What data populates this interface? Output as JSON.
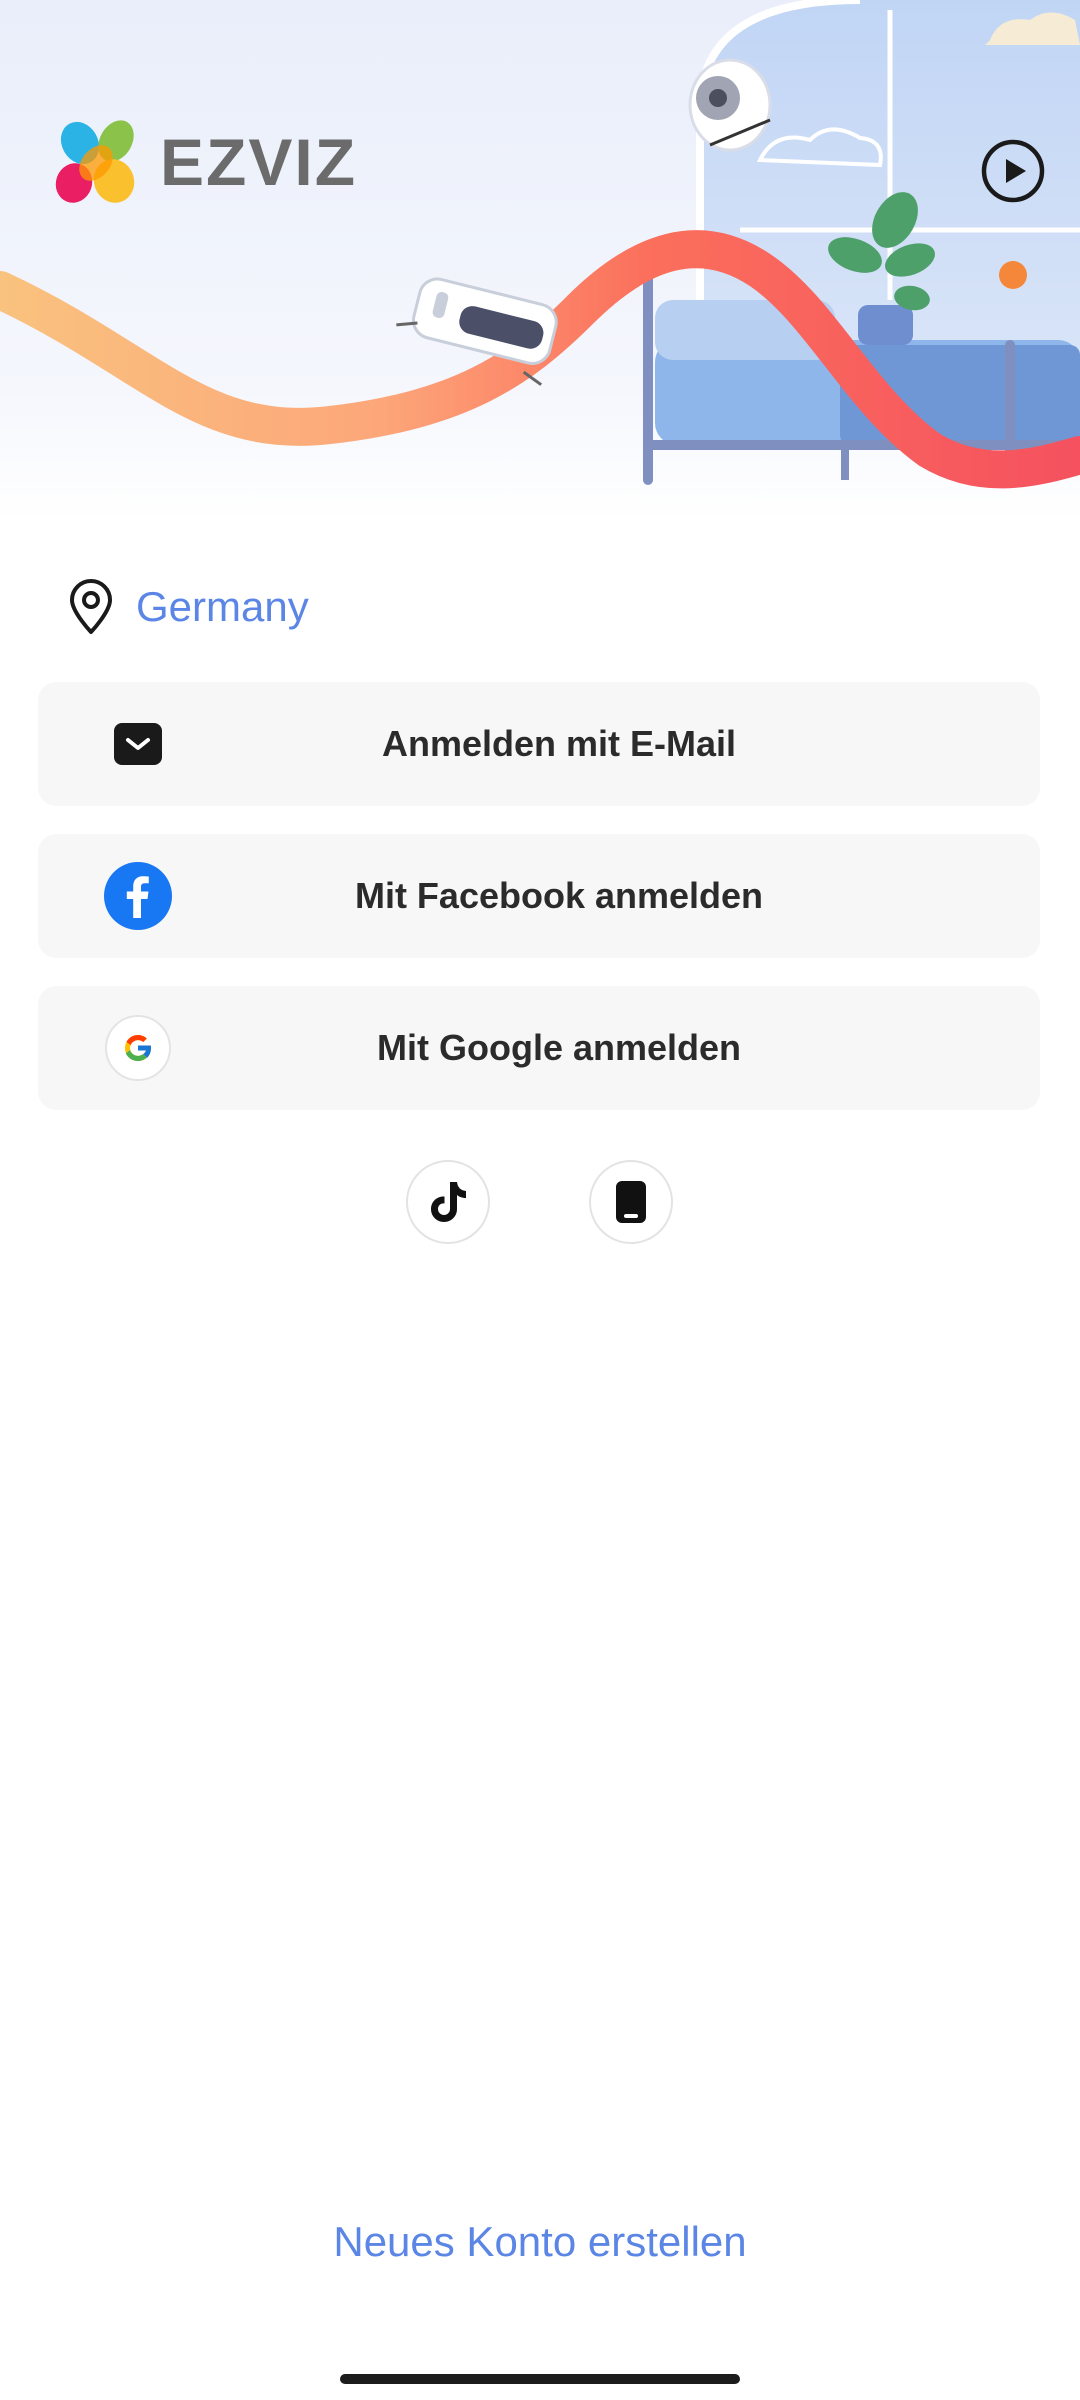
{
  "brand": {
    "name": "EZVIZ"
  },
  "hero": {
    "play_icon": "play-circle-icon"
  },
  "region": {
    "icon": "location-pin-icon",
    "label": "Germany"
  },
  "login_options": [
    {
      "icon": "mail-icon",
      "label": "Anmelden mit E-Mail"
    },
    {
      "icon": "facebook-icon",
      "label": "Mit Facebook anmelden",
      "color": "#1877F2"
    },
    {
      "icon": "google-icon",
      "label": "Mit Google anmelden"
    }
  ],
  "other_options": [
    {
      "icon": "tiktok-icon"
    },
    {
      "icon": "phone-icon"
    }
  ],
  "footer": {
    "create_account": "Neues Konto erstellen"
  },
  "colors": {
    "accent": "#5B86E5",
    "button_bg": "#F7F7F7",
    "text": "#2B2B2B"
  }
}
